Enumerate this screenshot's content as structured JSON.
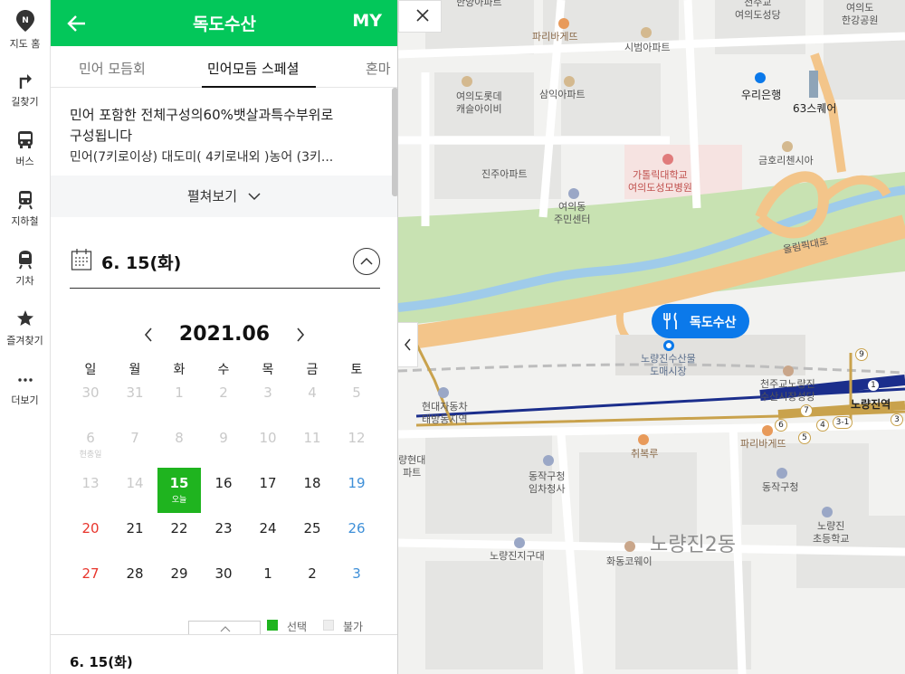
{
  "rail": {
    "items": [
      {
        "label": "지도 홈",
        "icon": "map-home-icon"
      },
      {
        "label": "길찾기",
        "icon": "directions-icon"
      },
      {
        "label": "버스",
        "icon": "bus-icon"
      },
      {
        "label": "지하철",
        "icon": "subway-icon"
      },
      {
        "label": "기차",
        "icon": "train-icon"
      },
      {
        "label": "즐겨찾기",
        "icon": "star-icon"
      },
      {
        "label": "더보기",
        "icon": "more-icon"
      }
    ]
  },
  "header": {
    "title": "독도수산",
    "my_label": "MY"
  },
  "tabs": [
    {
      "label": "민어 모듬회"
    },
    {
      "label": "민어모듬 스페셜"
    },
    {
      "label": "혼마"
    }
  ],
  "description": {
    "line1": "민어 포함한 전체구성의60%뱃살과특수부위로",
    "line2": "구성됩니다",
    "line3": "민어(7키로이상) 대도미( 4키로내외 )농어 (3키..."
  },
  "expand_label": "펼쳐보기",
  "selected_date_label": "6. 15(화)",
  "calendar": {
    "month_title": "2021.06",
    "weekdays": [
      "일",
      "월",
      "화",
      "수",
      "목",
      "금",
      "토"
    ],
    "weeks": [
      [
        {
          "d": "30",
          "s": "dim"
        },
        {
          "d": "31",
          "s": "dim"
        },
        {
          "d": "1",
          "s": "dim"
        },
        {
          "d": "2",
          "s": "dim"
        },
        {
          "d": "3",
          "s": "dim"
        },
        {
          "d": "4",
          "s": "dim"
        },
        {
          "d": "5",
          "s": "dim"
        }
      ],
      [
        {
          "d": "6",
          "s": "dim",
          "sub": "현충일"
        },
        {
          "d": "7",
          "s": "dim"
        },
        {
          "d": "8",
          "s": "dim"
        },
        {
          "d": "9",
          "s": "dim"
        },
        {
          "d": "10",
          "s": "dim"
        },
        {
          "d": "11",
          "s": "dim"
        },
        {
          "d": "12",
          "s": "dim"
        }
      ],
      [
        {
          "d": "13",
          "s": "dim"
        },
        {
          "d": "14",
          "s": "dim"
        },
        {
          "d": "15",
          "s": "sel",
          "sub": "오늘"
        },
        {
          "d": "16",
          "s": ""
        },
        {
          "d": "17",
          "s": ""
        },
        {
          "d": "18",
          "s": ""
        },
        {
          "d": "19",
          "s": "sat"
        }
      ],
      [
        {
          "d": "20",
          "s": "sun"
        },
        {
          "d": "21",
          "s": ""
        },
        {
          "d": "22",
          "s": ""
        },
        {
          "d": "23",
          "s": ""
        },
        {
          "d": "24",
          "s": ""
        },
        {
          "d": "25",
          "s": ""
        },
        {
          "d": "26",
          "s": "sat"
        }
      ],
      [
        {
          "d": "27",
          "s": "sun"
        },
        {
          "d": "28",
          "s": ""
        },
        {
          "d": "29",
          "s": ""
        },
        {
          "d": "30",
          "s": ""
        },
        {
          "d": "1",
          "s": ""
        },
        {
          "d": "2",
          "s": ""
        },
        {
          "d": "3",
          "s": "sat"
        }
      ]
    ]
  },
  "legend": {
    "selected_label": "선택",
    "unavailable_label": "불가",
    "selected_color": "#1fb41f",
    "unavailable_color": "#eeeeee"
  },
  "bottom_date_label": "6. 15(화)",
  "map": {
    "pin_label": "독도수산",
    "labels": {
      "hanyang": "한양아파트",
      "paris_top": "파리바게뜨",
      "yeouido_cathedral": "천주교\n여의도성당",
      "yeouido_park": "여의도\n한강공원",
      "sibeom": "시범아파트",
      "lotte_castle": "여의도롯데\n캐슬아이비",
      "samik": "삼익아파트",
      "woori": "우리은행",
      "sq63": "63스퀘어",
      "jinju_top": "진주아파트",
      "catholic_hospital": "가톨릭대학교\n여의도성모병원",
      "geumho": "금호리첸시아",
      "yeouido_center": "여의동\n주민센터",
      "olympic_road": "올림픽대로",
      "noryangjin_market": "노량진수산물\n도매시장",
      "cathedral_noryangjin": "천주교노량진\n수산시장성당",
      "noryangjin_station": "노량진역",
      "hyundai_car": "현대자동차\n태방동지역",
      "paris_bottom": "파리바게뜨",
      "chwibokru": "취복루",
      "hyundai_apt": "량현대\n파트",
      "dongjak_office": "동작구청\n임차청사",
      "dongjak_gu": "동작구청",
      "noryangjin_school": "노량진\n초등학교",
      "noryangjin_police": "노량진지구대",
      "hwadong": "화동코웨이",
      "noryangjin2": "노량진2동"
    },
    "subway_numbers": [
      "9",
      "1",
      "7",
      "4",
      "6",
      "5",
      "3-1",
      "3"
    ]
  }
}
